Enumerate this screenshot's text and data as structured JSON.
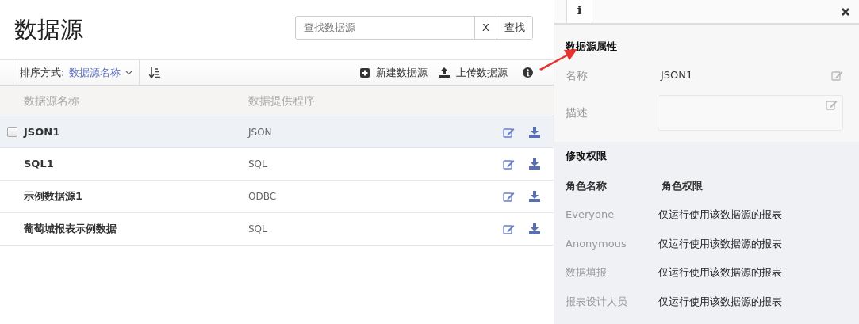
{
  "title": "数据源",
  "search": {
    "placeholder": "查找数据源",
    "clear_label": "X",
    "button": "查找"
  },
  "toolbar": {
    "sort_label": "排序方式:",
    "sort_value": "数据源名称",
    "actions": [
      {
        "kind": "new",
        "label": "新建数据源"
      },
      {
        "kind": "upload",
        "label": "上传数据源"
      }
    ]
  },
  "table": {
    "columns": [
      "数据源名称",
      "数据提供程序"
    ],
    "rows": [
      {
        "name": "JSON1",
        "provider": "JSON",
        "selected": true
      },
      {
        "name": "SQL1",
        "provider": "SQL",
        "selected": false
      },
      {
        "name": "示例数据源1",
        "provider": "ODBC",
        "selected": false
      },
      {
        "name": "葡萄城报表示例数据",
        "provider": "SQL",
        "selected": false
      }
    ]
  },
  "panel": {
    "tabs": [
      {
        "label": "i",
        "selected": true
      }
    ],
    "properties": {
      "title": "数据源属性",
      "fields": [
        {
          "kind": "text",
          "label": "名称",
          "value": "JSON1"
        },
        {
          "kind": "textarea",
          "label": "描述"
        }
      ]
    },
    "permissions": {
      "title": "修改权限",
      "columns": [
        "角色名称",
        "角色权限"
      ],
      "rows": [
        {
          "role": "Everyone",
          "permission": "仅运行使用该数据源的报表"
        },
        {
          "role": "Anonymous",
          "permission": "仅运行使用该数据源的报表"
        },
        {
          "role": "数据填报",
          "permission": "仅运行使用该数据源的报表"
        },
        {
          "role": "报表设计人员",
          "permission": "仅运行使用该数据源的报表"
        }
      ]
    }
  }
}
